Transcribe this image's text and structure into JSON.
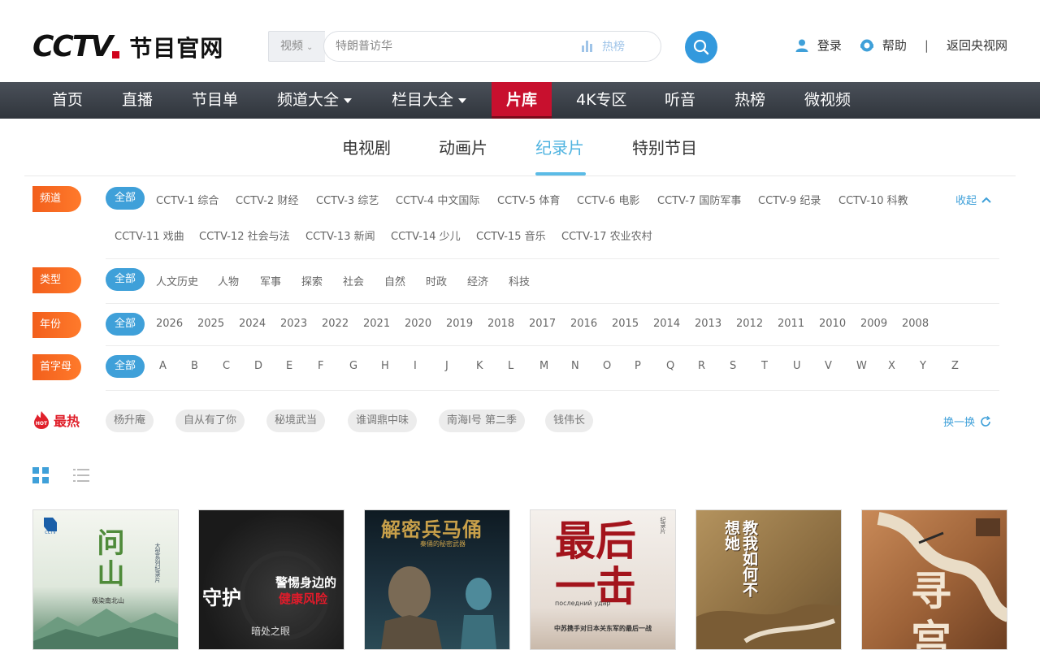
{
  "header": {
    "logo_text": "CCTV",
    "logo_sub": "节目官网",
    "search": {
      "type_label": "视频",
      "placeholder": "特朗普访华",
      "hot_label": "热榜"
    },
    "login": "登录",
    "help": "帮助",
    "separator": "|",
    "back_link": "返回央视网"
  },
  "nav": {
    "items": [
      "首页",
      "直播",
      "节目单",
      "频道大全",
      "栏目大全",
      "片库",
      "4K专区",
      "听音",
      "热榜",
      "微视频"
    ],
    "active": "片库"
  },
  "subtabs": {
    "items": [
      "电视剧",
      "动画片",
      "纪录片",
      "特别节目"
    ],
    "active": "纪录片"
  },
  "filters": {
    "channel": {
      "label": "频道",
      "all": "全部",
      "row1": [
        "CCTV-1 综合",
        "CCTV-2 财经",
        "CCTV-3 综艺",
        "CCTV-4 中文国际",
        "CCTV-5 体育",
        "CCTV-6 电影",
        "CCTV-7 国防军事",
        "CCTV-9 纪录",
        "CCTV-10 科教"
      ],
      "row2": [
        "CCTV-11 戏曲",
        "CCTV-12 社会与法",
        "CCTV-13 新闻",
        "CCTV-14 少儿",
        "CCTV-15 音乐",
        "CCTV-17 农业农村"
      ],
      "collapse": "收起"
    },
    "type": {
      "label": "类型",
      "all": "全部",
      "options": [
        "人文历史",
        "人物",
        "军事",
        "探索",
        "社会",
        "自然",
        "时政",
        "经济",
        "科技"
      ]
    },
    "year": {
      "label": "年份",
      "all": "全部",
      "options": [
        "2026",
        "2025",
        "2024",
        "2023",
        "2022",
        "2021",
        "2020",
        "2019",
        "2018",
        "2017",
        "2016",
        "2015",
        "2014",
        "2013",
        "2012",
        "2011",
        "2010",
        "2009",
        "2008"
      ]
    },
    "letter": {
      "label": "首字母",
      "all": "全部",
      "options": [
        "A",
        "B",
        "C",
        "D",
        "E",
        "F",
        "G",
        "H",
        "I",
        "J",
        "K",
        "L",
        "M",
        "N",
        "O",
        "P",
        "Q",
        "R",
        "S",
        "T",
        "U",
        "V",
        "W",
        "X",
        "Y",
        "Z"
      ]
    }
  },
  "hot": {
    "badge": "HOT",
    "title": "最热",
    "tags": [
      "杨升庵",
      "自从有了你",
      "秘境武当",
      "谁调鼎中味",
      "南海Ⅰ号 第二季",
      "钱伟长"
    ],
    "refresh": "换一换"
  },
  "posters": [
    {
      "title": "问山",
      "subtitle": "大型系列纪录片",
      "caption": "极染南北山",
      "bg": "#e8eee4"
    },
    {
      "title": "守护",
      "subtitle": "警惕身边的",
      "subtitle2": "健康风险",
      "caption": "暗处之眼",
      "bg": "#1c1c1c"
    },
    {
      "title": "解密兵马俑",
      "subtitle": "秦俑的秘密武器",
      "bg": "#1a2a33"
    },
    {
      "title": "最后一击",
      "subtitle": "纪录片",
      "caption_ru": "последний удар",
      "caption": "中苏携手对日本关东军的最后一战",
      "bg": "#efe9e4"
    },
    {
      "title": "教我如何不想她",
      "bg": "#9a7c4c"
    },
    {
      "title": "寻宫",
      "bg": "#8b5a3a"
    }
  ]
}
